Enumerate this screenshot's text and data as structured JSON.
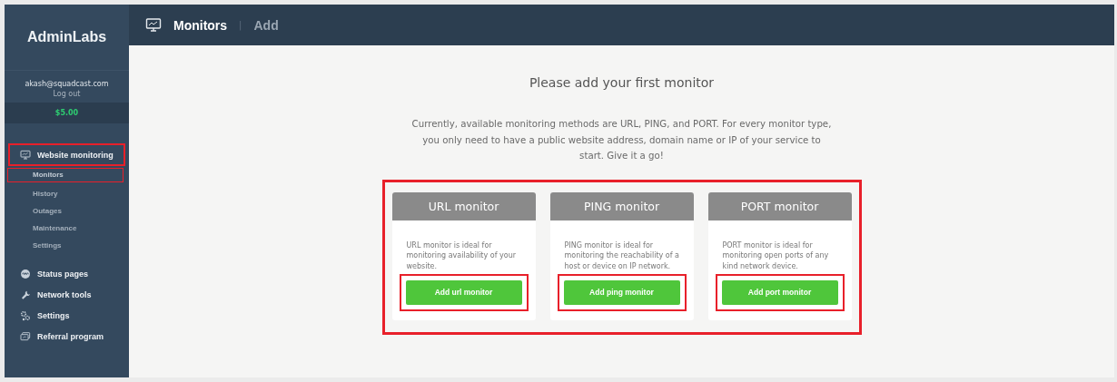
{
  "sidebar": {
    "logo": "AdminLabs",
    "user": {
      "email": "akash@squadcast.com",
      "logout": "Log out"
    },
    "balance": "$5.00",
    "items": [
      {
        "label": "Website monitoring",
        "highlighted": true,
        "children": [
          {
            "label": "Monitors",
            "highlighted": true
          },
          {
            "label": "History",
            "highlighted": false
          },
          {
            "label": "Outages",
            "highlighted": false
          },
          {
            "label": "Maintenance",
            "highlighted": false
          },
          {
            "label": "Settings",
            "highlighted": false
          }
        ]
      },
      {
        "label": "Status pages",
        "highlighted": false
      },
      {
        "label": "Network tools",
        "highlighted": false
      },
      {
        "label": "Settings",
        "highlighted": false
      },
      {
        "label": "Referral program",
        "highlighted": false
      }
    ]
  },
  "header": {
    "title": "Monitors",
    "separator": "|",
    "subtitle": "Add"
  },
  "content": {
    "title": "Please add your first monitor",
    "intro": "Currently, available monitoring methods are URL, PING, and PORT. For every monitor type, you only need to have a public website address, domain name or IP of your service to start. Give it a go!",
    "cards_highlighted": true,
    "cards": [
      {
        "title": "URL monitor",
        "description": "URL monitor is ideal for monitoring availability of your website.",
        "button": "Add url monitor",
        "highlighted": true
      },
      {
        "title": "PING monitor",
        "description": "PING monitor is ideal for monitoring the reachability of a host or device on IP network.",
        "button": "Add ping monitor",
        "highlighted": true
      },
      {
        "title": "PORT monitor",
        "description": "PORT monitor is ideal for monitoring open ports of any kind network device.",
        "button": "Add port monitor",
        "highlighted": true
      }
    ]
  }
}
